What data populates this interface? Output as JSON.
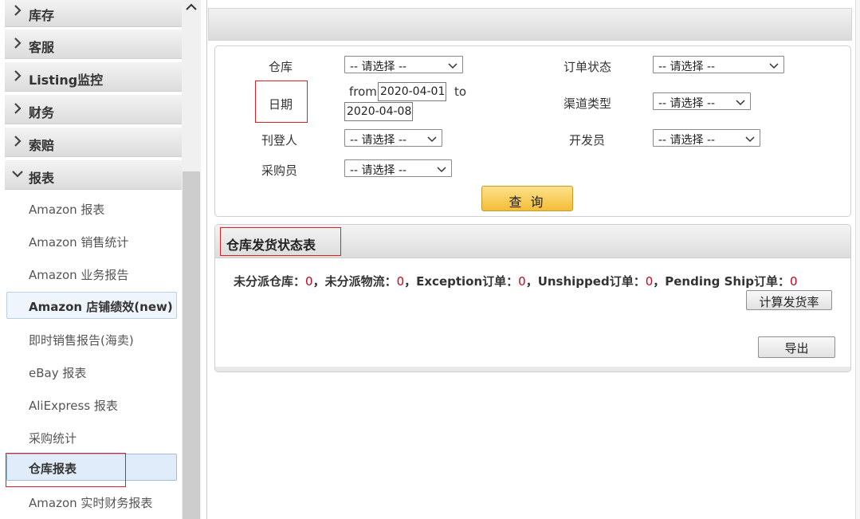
{
  "sidebar": {
    "groups": [
      {
        "label": "库存",
        "expanded": false
      },
      {
        "label": "客服",
        "expanded": false
      },
      {
        "label": "Listing监控",
        "expanded": false
      },
      {
        "label": "财务",
        "expanded": false
      },
      {
        "label": "索赔",
        "expanded": false
      },
      {
        "label": "报表",
        "expanded": true
      }
    ],
    "items": [
      {
        "label": "Amazon 报表"
      },
      {
        "label": "Amazon 销售统计"
      },
      {
        "label": "Amazon 业务报告"
      },
      {
        "label": "Amazon 店铺绩效(new)"
      },
      {
        "label": "即时销售报告(海卖)"
      },
      {
        "label": "eBay 报表"
      },
      {
        "label": "AliExpress 报表"
      },
      {
        "label": "采购统计"
      },
      {
        "label": "仓库报表",
        "selected": true
      },
      {
        "label": "Amazon 实时财务报表"
      }
    ]
  },
  "filter": {
    "warehouse_label": "仓库",
    "warehouse_value": "-- 请选择 --",
    "order_status_label": "订单状态",
    "order_status_value": "-- 请选择 --",
    "date_label": "日期",
    "from_text": "from",
    "from_value": "2020-04-01",
    "to_text": "to",
    "to_value": "2020-04-08",
    "channel_type_label": "渠道类型",
    "channel_type_value": "-- 请选择 --",
    "publisher_label": "刊登人",
    "publisher_value": "-- 请选择 --",
    "developer_label": "开发员",
    "developer_value": "-- 请选择 --",
    "buyer_label": "采购员",
    "buyer_value": "-- 请选择 --",
    "query_button": "查 询"
  },
  "status_panel": {
    "title": "仓库发货状态表",
    "unassigned_warehouse_label": "未分派仓库：",
    "unassigned_warehouse_count": "0",
    "unassigned_logistics_label": "，未分派物流：",
    "unassigned_logistics_count": "0",
    "exception_label": "，Exception订单：",
    "exception_count": "0",
    "unshipped_label": "，Unshipped订单：",
    "unshipped_count": "0",
    "pending_label": "，Pending Ship订单：",
    "pending_count": "0",
    "calc_button": "计算发货率",
    "export_button": "导出"
  },
  "colors": {
    "highlight_box": "#e02020",
    "count_red": "#d0021b",
    "query_button": "#f3bd38"
  }
}
